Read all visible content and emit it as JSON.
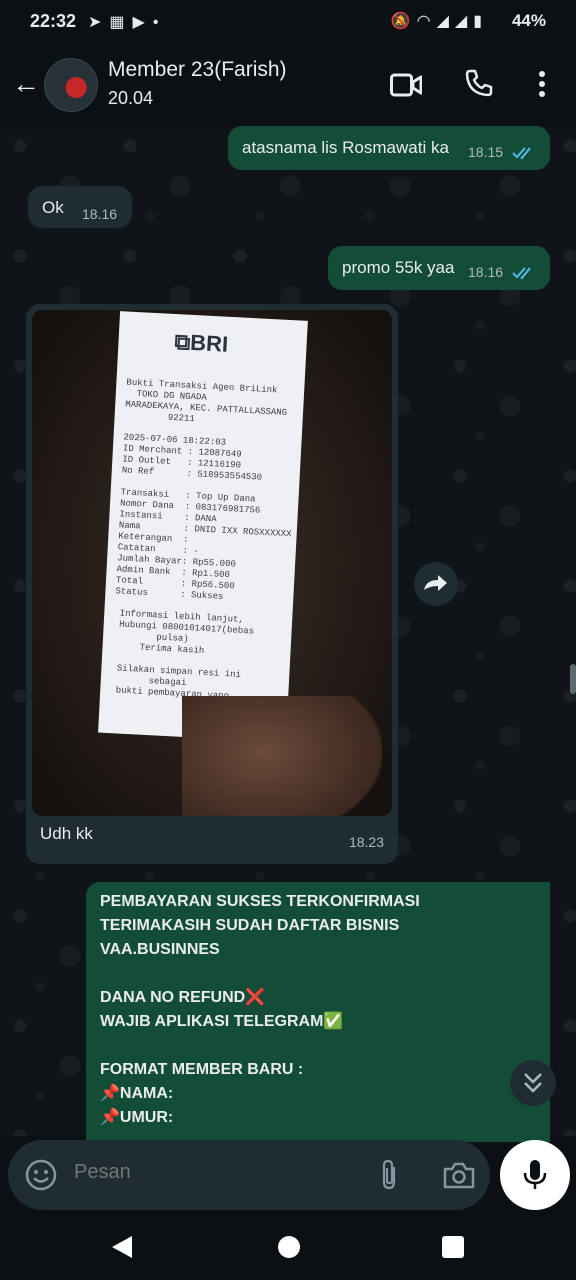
{
  "status_bar": {
    "time": "22:32",
    "left_icons": [
      "telegram-icon",
      "sim-icon",
      "play-icon",
      "dot-icon"
    ],
    "right_icons": [
      "mute-icon",
      "wifi-icon",
      "signal-icon",
      "signal-icon",
      "battery-icon"
    ],
    "battery": "44%"
  },
  "header": {
    "contact_name": "Member 23(Farish)",
    "subtitle": "20.04"
  },
  "messages": [
    {
      "direction": "out",
      "text": "atasnama lis Rosmawati ka",
      "time": "18.15",
      "read": true
    },
    {
      "direction": "in",
      "text": "Ok",
      "time": "18.16"
    },
    {
      "direction": "out",
      "text": "promo 55k yaa",
      "time": "18.16",
      "read": true
    },
    {
      "direction": "in",
      "type": "image",
      "caption": "Udh kk",
      "time": "18.23",
      "receipt": {
        "logo": "BRI",
        "lines": [
          "Bukti Transaksi Agen BriLink",
          "  TOKO DG NGADA",
          "MARADEKAYA, KEC. PATTALLASSANG",
          "        92211",
          "",
          "2025-07-06 18:22:03",
          "ID Merchant : 12087649",
          "ID Outlet   : 12116190",
          "No Ref      : 518953554530",
          "",
          "Transaksi   : Top Up Dana",
          "Nomor Dana  : 083176981756",
          "Instansi    : DANA",
          "Nama        : DNID IXX ROSXXXXXX",
          "Keterangan  :",
          "Catatan     : -",
          "Jumlah Bayar: Rp55.000",
          "Admin Bank  : Rp1.500",
          "Total       : Rp56.500",
          "Status      : Sukses",
          "",
          " Informasi lebih lanjut,",
          " Hubungi 08001014017(bebas",
          "        pulsa)",
          "     Terima kasih",
          "",
          " Silakan simpan resi ini",
          "       sebagai",
          " bukti pembayaran yang"
        ]
      }
    },
    {
      "direction": "out",
      "lines": [
        "PEMBAYARAN SUKSES TERKONFIRMASI",
        "TERIMAKASIH SUDAH DAFTAR BISNIS",
        "VAA.BUSINNES",
        "",
        "DANA NO REFUND❌",
        "WAJIB APLIKASI TELEGRAM✅",
        "",
        "FORMAT MEMBER BARU :",
        "📌NAMA:",
        "📌UMUR:"
      ]
    }
  ],
  "composer": {
    "placeholder": "Pesan"
  },
  "colors": {
    "outgoing_bubble": "#144d37",
    "incoming_bubble": "#1f2c33",
    "read_ticks": "#53bdeb",
    "background": "#0b1014"
  }
}
